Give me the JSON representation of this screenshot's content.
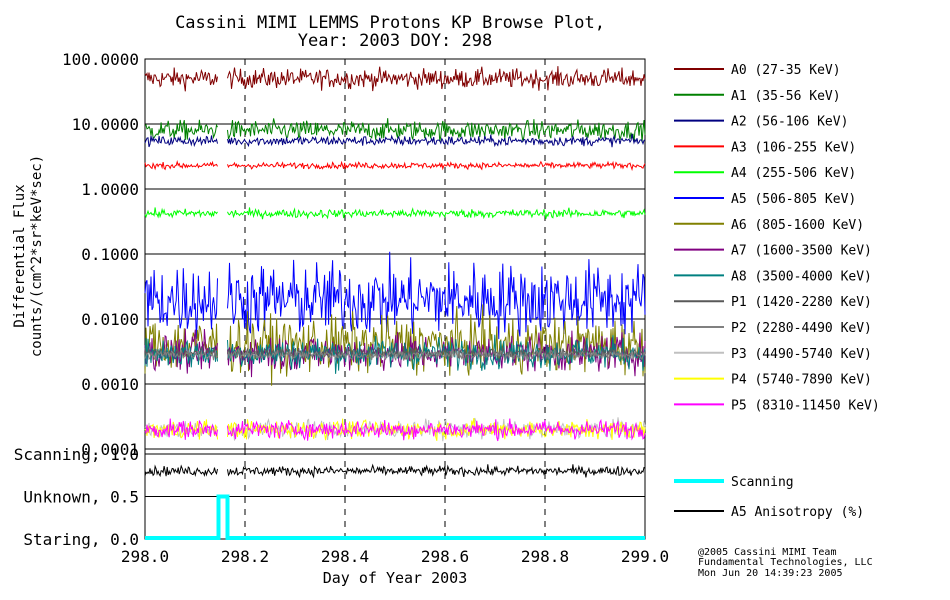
{
  "chart_data": {
    "type": "line",
    "title": "Cassini MIMI LEMMS Protons KP Browse Plot,",
    "subtitle": "Year: 2003 DOY: 298",
    "xlabel": "Day of Year 2003",
    "ylabel": "Differential Flux",
    "ylabel2": "counts/(cm^2*sr*keV*sec)",
    "xlim": [
      298.0,
      299.0
    ],
    "xticks": [
      "298.0",
      "298.2",
      "298.4",
      "298.6",
      "298.8",
      "299.0"
    ],
    "ylim": [
      0.0001,
      100.0
    ],
    "yscale": "log",
    "yticks": [
      "100.0000",
      "10.0000",
      "1.0000",
      "0.1000",
      "0.0100",
      "0.0010",
      "0.0001"
    ],
    "grid": true,
    "legend_position": "right",
    "series": [
      {
        "name": "A0 (27-35 KeV)",
        "color": "#800000",
        "level": 50,
        "spread": 0.16,
        "gap": [
          298.145,
          298.165
        ]
      },
      {
        "name": "A1 (35-56 KeV)",
        "color": "#008000",
        "level": 8,
        "spread": 0.16,
        "gap": [
          298.145,
          298.165
        ]
      },
      {
        "name": "A2 (56-106 KeV)",
        "color": "#000080",
        "level": 5.5,
        "spread": 0.08,
        "gap": [
          298.145,
          298.165
        ]
      },
      {
        "name": "A3 (106-255 KeV)",
        "color": "#ff0000",
        "level": 2.3,
        "spread": 0.05,
        "gap": [
          298.145,
          298.165
        ]
      },
      {
        "name": "A4 (255-506 KeV)",
        "color": "#00ff00",
        "level": 0.42,
        "spread": 0.07,
        "gap": [
          298.145,
          298.165
        ]
      },
      {
        "name": "A5 (506-805 KeV)",
        "color": "#0000ff",
        "level": 0.02,
        "spread": 0.6,
        "gap": [
          298.145,
          298.165
        ]
      },
      {
        "name": "A6 (805-1600 KeV)",
        "color": "#808000",
        "level": 0.004,
        "spread": 0.45,
        "gap": [
          298.145,
          298.165
        ]
      },
      {
        "name": "A7 (1600-3500 KeV)",
        "color": "#800080",
        "level": 0.003,
        "spread": 0.3,
        "gap": [
          298.145,
          298.165
        ]
      },
      {
        "name": "A8 (3500-4000 KeV)",
        "color": "#008080",
        "level": 0.003,
        "spread": 0.25,
        "gap": [
          298.145,
          298.165
        ]
      },
      {
        "name": "P1 (1420-2280 KeV)",
        "color": "#595959",
        "level": 0.003,
        "spread": 0.08,
        "gap": [
          298.145,
          298.165
        ]
      },
      {
        "name": "P2 (2280-4490 KeV)",
        "color": "#808080",
        "level": 0.0028,
        "spread": 0.08,
        "gap": [
          298.145,
          298.165
        ]
      },
      {
        "name": "P3 (4490-5740 KeV)",
        "color": "#c0c0c0",
        "level": 0.0002,
        "spread": 0.15,
        "gap": [
          298.145,
          298.165
        ]
      },
      {
        "name": "P4 (5740-7890 KeV)",
        "color": "#ffff00",
        "level": 0.0002,
        "spread": 0.15,
        "gap": [
          298.145,
          298.165
        ]
      },
      {
        "name": "P5 (8310-11450 KeV)",
        "color": "#ff00ff",
        "level": 0.0002,
        "spread": 0.15,
        "gap": [
          298.145,
          298.165
        ]
      }
    ],
    "lower_panel": {
      "ylabels": [
        "Scanning, 1.0",
        "Unknown, 0.5",
        "Staring, 0.0"
      ],
      "yvalues": [
        1.0,
        0.5,
        0.0
      ],
      "series": [
        {
          "name": "Scanning",
          "color": "#00ffff",
          "points": [
            [
              298.0,
              0.0
            ],
            [
              298.147,
              0.0
            ],
            [
              298.147,
              0.5
            ],
            [
              298.165,
              0.5
            ],
            [
              298.165,
              0.0
            ],
            [
              299.0,
              0.0
            ]
          ]
        },
        {
          "name": "A5 Anisotropy (%)",
          "color": "#000000",
          "level": 0.8,
          "gap": [
            298.145,
            298.165
          ]
        }
      ]
    },
    "footer": [
      "@2005 Cassini MIMI Team",
      "Fundamental Technologies, LLC",
      "Mon Jun 20 14:39:23 2005"
    ]
  }
}
